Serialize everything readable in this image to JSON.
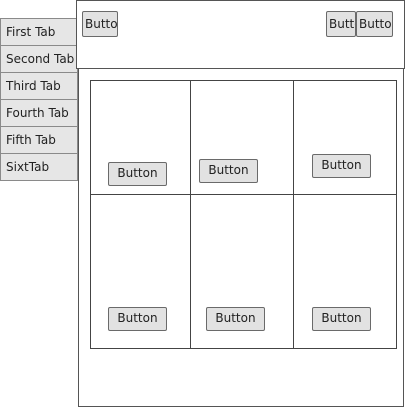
{
  "tabs": [
    {
      "label": "First Tab"
    },
    {
      "label": "Second Tab"
    },
    {
      "label": "Third Tab"
    },
    {
      "label": "Fourth Tab"
    },
    {
      "label": "Fifth Tab"
    },
    {
      "label": "SixtTab"
    }
  ],
  "toolbar": {
    "left_button": "Button",
    "right_button_1": "Button",
    "right_button_2": "Button"
  },
  "grid": {
    "cells": [
      {
        "button": "Button"
      },
      {
        "button": "Button"
      },
      {
        "button": "Button"
      },
      {
        "button": "Button"
      },
      {
        "button": "Button"
      },
      {
        "button": "Button"
      }
    ]
  }
}
